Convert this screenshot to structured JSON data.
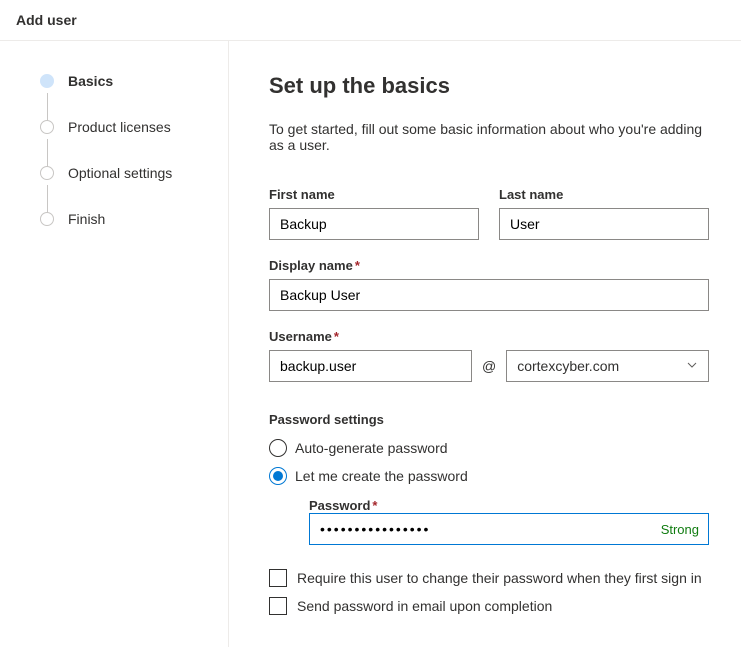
{
  "header": {
    "title": "Add user"
  },
  "steps": [
    {
      "label": "Basics",
      "active": true
    },
    {
      "label": "Product licenses",
      "active": false
    },
    {
      "label": "Optional settings",
      "active": false
    },
    {
      "label": "Finish",
      "active": false
    }
  ],
  "main": {
    "title": "Set up the basics",
    "subtitle": "To get started, fill out some basic information about who you're adding as a user.",
    "labels": {
      "first_name": "First name",
      "last_name": "Last name",
      "display_name": "Display name",
      "username": "Username",
      "password_settings": "Password settings",
      "password": "Password",
      "at": "@"
    },
    "values": {
      "first_name": "Backup",
      "last_name": "User",
      "display_name": "Backup User",
      "username": "backup.user",
      "domain": "cortexcyber.com",
      "password_masked": "••••••••••••••••",
      "password_strength": "Strong"
    },
    "radio": {
      "auto": "Auto-generate password",
      "manual": "Let me create the password",
      "selected": "manual"
    },
    "checkboxes": {
      "require_change": "Require this user to change their password when they first sign in",
      "send_email": "Send password in email upon completion"
    }
  }
}
